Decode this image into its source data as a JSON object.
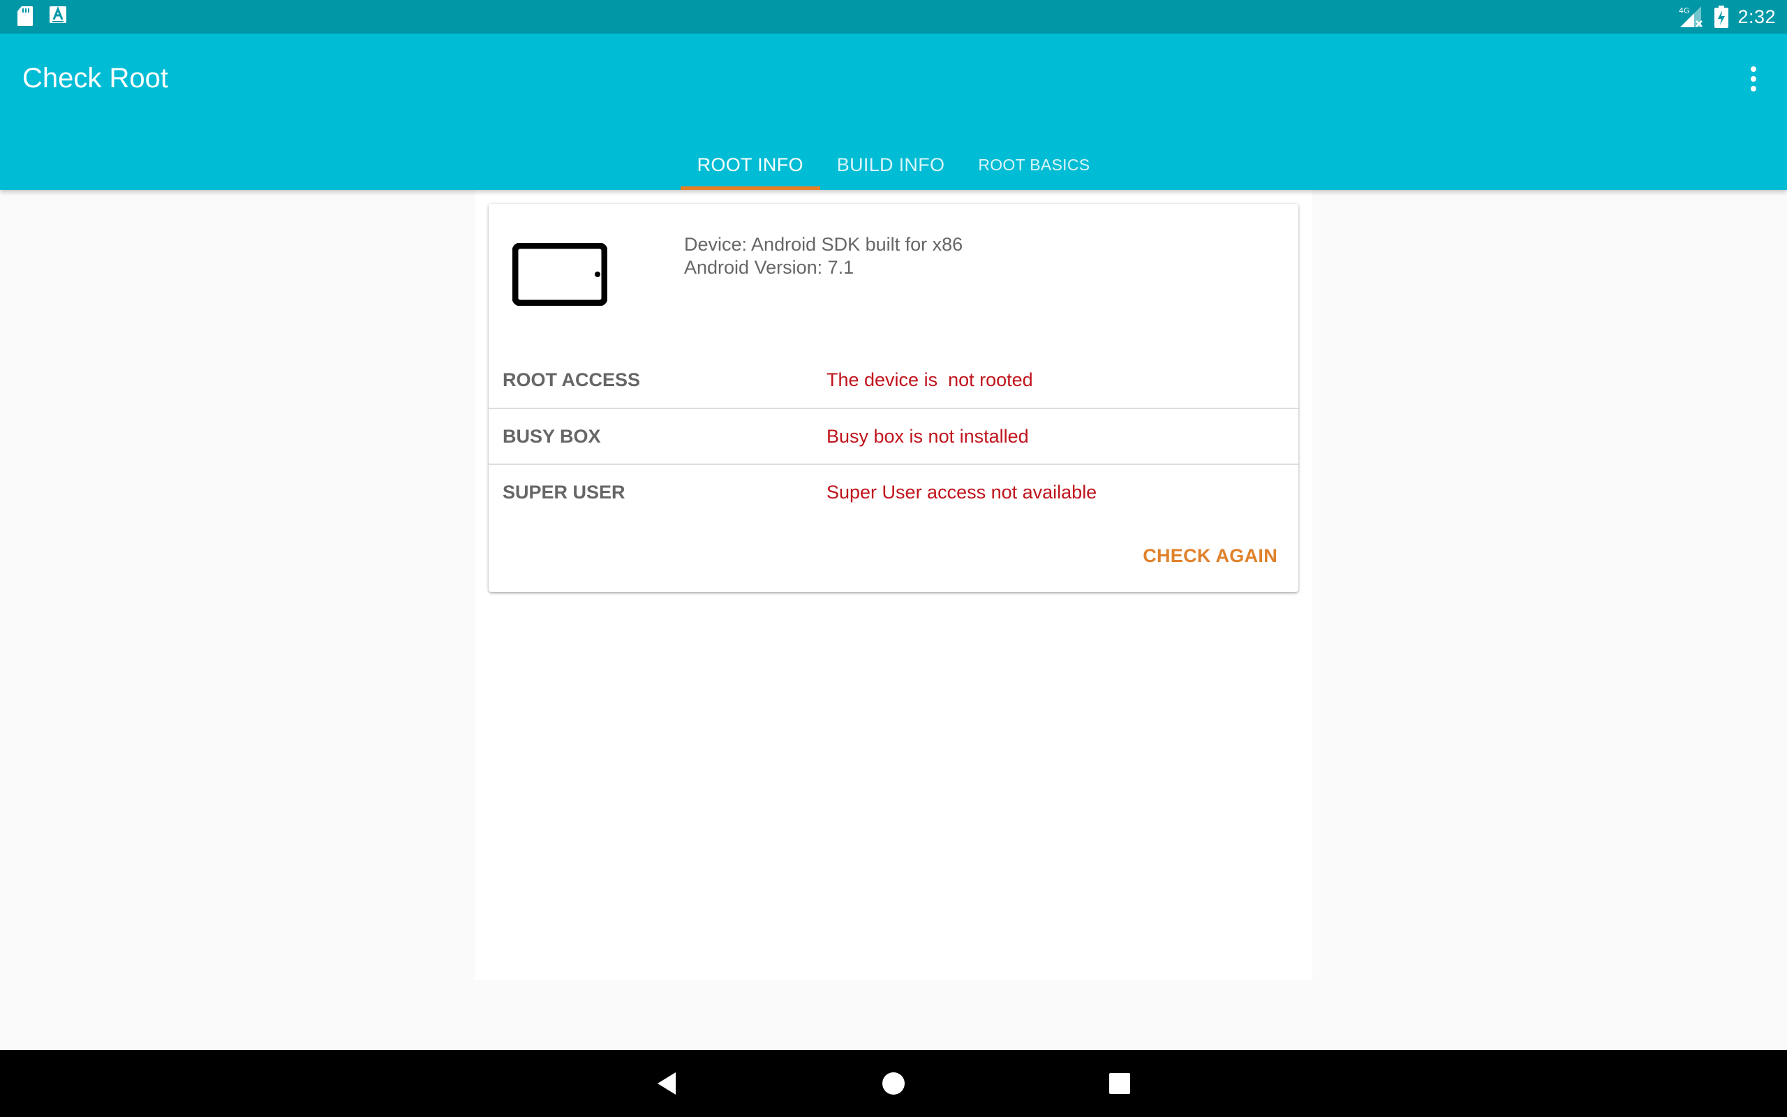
{
  "status_bar": {
    "time": "2:32",
    "network_label": "4G",
    "icons": [
      "sd-card-icon",
      "text-notification-icon",
      "signal-icon",
      "battery-charging-icon"
    ]
  },
  "app_bar": {
    "title": "Check Root",
    "menu_icon": "more-vert-icon"
  },
  "tabs": [
    {
      "label": "ROOT INFO",
      "active": true
    },
    {
      "label": "BUILD INFO",
      "active": false
    },
    {
      "label": "ROOT BASICS",
      "active": false
    }
  ],
  "card": {
    "device_icon": "tablet-icon",
    "device_line": "Device: Android SDK built for x86",
    "version_line": "Android Version: 7.1",
    "rows": [
      {
        "label": "ROOT ACCESS",
        "value": "The device is  not rooted"
      },
      {
        "label": "BUSY BOX",
        "value": "Busy box is not installed"
      },
      {
        "label": "SUPER USER",
        "value": "Super User access not available"
      }
    ],
    "check_again_label": "CHECK AGAIN"
  },
  "nav_bar": {
    "icons": [
      "back-icon",
      "home-icon",
      "recent-apps-icon"
    ]
  },
  "colors": {
    "status_bar": "#0097a7",
    "app_bar": "#00bcd4",
    "tab_indicator": "#e67e22",
    "error_text": "#c0141c",
    "action_text": "#e0812b"
  }
}
